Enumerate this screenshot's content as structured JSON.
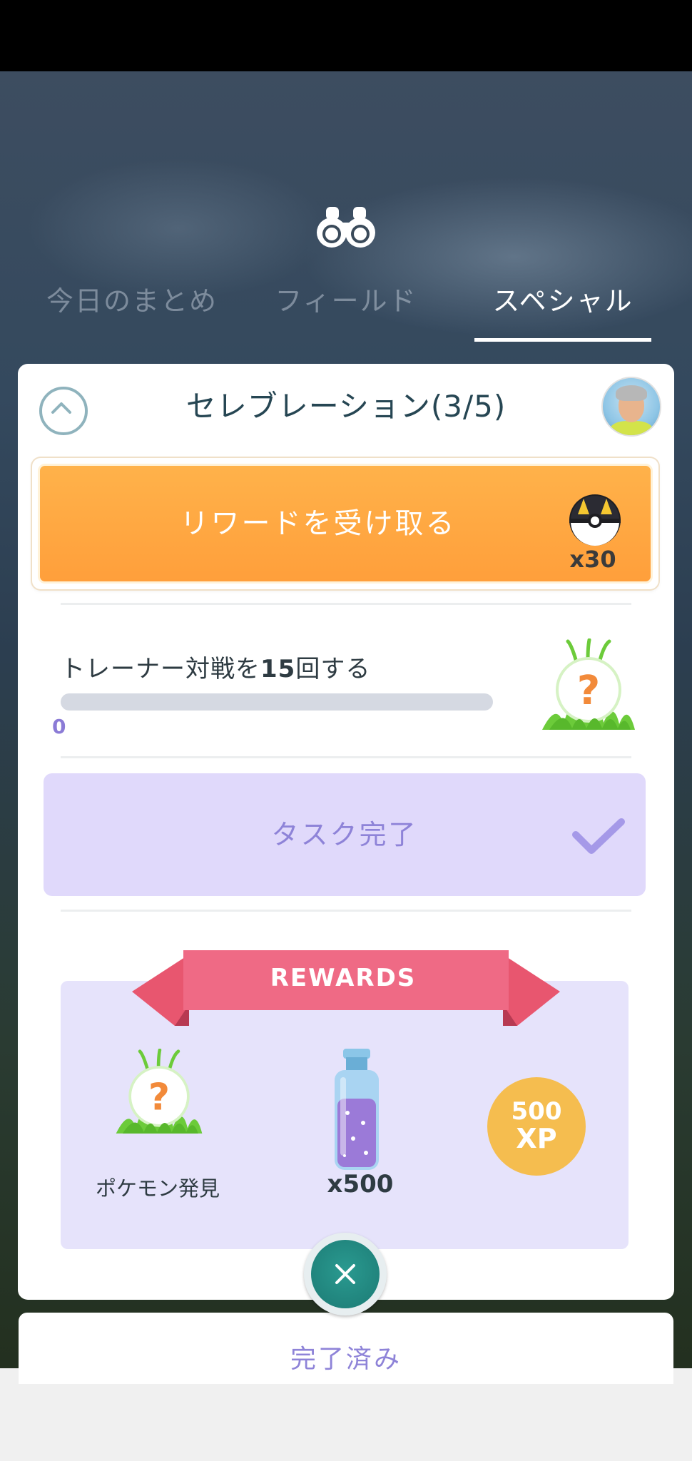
{
  "tabs": [
    {
      "label": "今日のまとめ",
      "active": false
    },
    {
      "label": "フィールド",
      "active": false
    },
    {
      "label": "スペシャル",
      "active": true
    }
  ],
  "card": {
    "title": "セレブレーション(3/5)",
    "reward_button": {
      "label": "リワードを受け取る",
      "item": "ultra-ball-icon",
      "count": "x30"
    },
    "task": {
      "prefix": "トレーナー対戦を",
      "number": "15",
      "suffix": "回する",
      "progress_value": "0",
      "progress_fraction": 0
    },
    "task_complete": {
      "label": "タスク完了"
    },
    "rewards": {
      "title": "REWARDS",
      "items": [
        {
          "label": "ポケモン発見",
          "icon": "mystery-pokemon-icon"
        },
        {
          "label": "x500",
          "icon": "stardust-icon"
        },
        {
          "value": "500",
          "unit": "XP",
          "icon": "xp-badge"
        }
      ]
    }
  },
  "completed_section": {
    "label": "完了済み"
  },
  "colors": {
    "accent_orange": "#ffa640",
    "accent_purple": "#8e83d8",
    "ribbon_pink": "#ef6a85",
    "xp_gold": "#f5bd4f",
    "close_teal": "#1f8a82"
  }
}
